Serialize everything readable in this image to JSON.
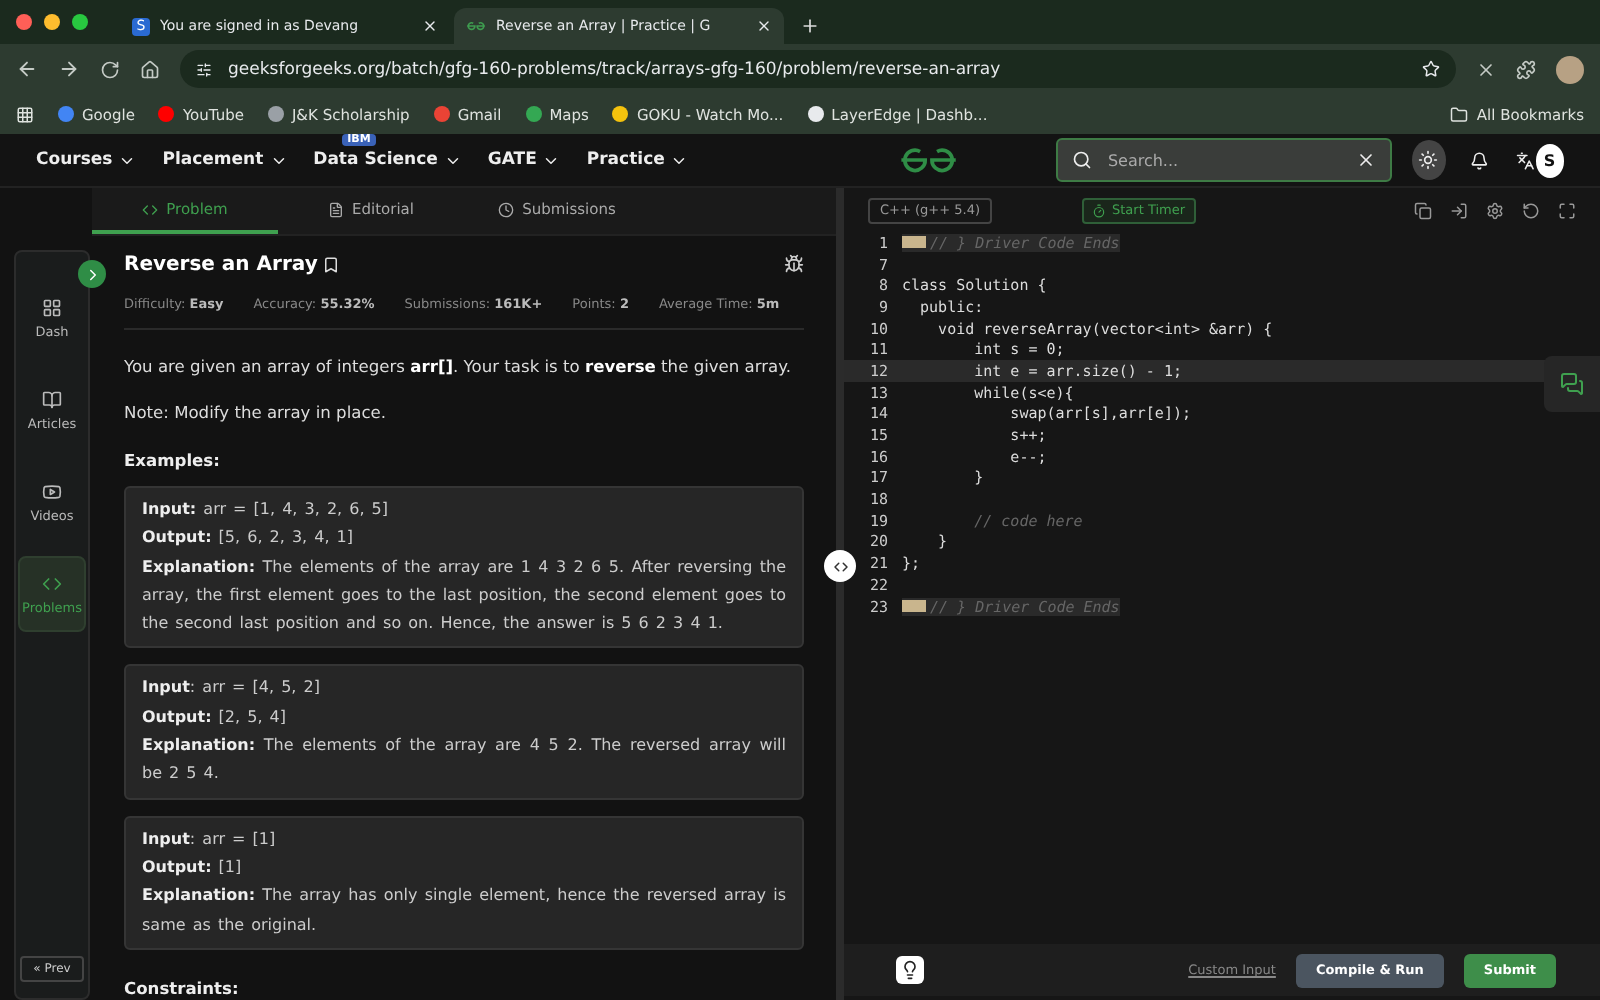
{
  "browser": {
    "tabs": [
      {
        "title": "You are signed in as Devang",
        "favicon": "S",
        "selected": false
      },
      {
        "title": "Reverse an Array | Practice | G",
        "selected": true
      }
    ],
    "url": "geeksforgeeks.org/batch/gfg-160-problems/track/arrays-gfg-160/problem/reverse-an-array",
    "bookmarks": [
      {
        "label": "Google",
        "color": "#4285f4"
      },
      {
        "label": "YouTube",
        "color": "#ff0000"
      },
      {
        "label": "J&K Scholarship",
        "color": "#9aa0a6"
      },
      {
        "label": "Gmail",
        "color": "#ea4335"
      },
      {
        "label": "Maps",
        "color": "#34a853"
      },
      {
        "label": "GOKU - Watch Mo...",
        "color": "#f4c20d"
      },
      {
        "label": "LayerEdge | Dashb...",
        "color": "#e8eaed"
      }
    ],
    "all_bookmarks": "All Bookmarks"
  },
  "nav": {
    "items": [
      {
        "label": "Courses"
      },
      {
        "label": "Placement"
      },
      {
        "label": "Data Science",
        "badge": "IBM"
      },
      {
        "label": "GATE"
      },
      {
        "label": "Practice"
      }
    ],
    "search": {
      "placeholder": "Search..."
    },
    "avatar": "S"
  },
  "problem_tabs": [
    {
      "label": "Problem",
      "selected": true
    },
    {
      "label": "Editorial",
      "selected": false
    },
    {
      "label": "Submissions",
      "selected": false
    }
  ],
  "sidebar": {
    "items": [
      {
        "label": "Dash",
        "selected": false
      },
      {
        "label": "Articles",
        "selected": false
      },
      {
        "label": "Videos",
        "selected": false
      },
      {
        "label": "Problems",
        "selected": true
      }
    ],
    "prev": "« Prev"
  },
  "problem": {
    "title": "Reverse an Array",
    "meta": [
      "Difficulty: **Easy**",
      "Accuracy: **55.32%**",
      "Submissions: **161K+**",
      "Points: **2**",
      "Average Time: **5m**"
    ],
    "paragraphs": [
      "You are given an array of integers **arr[]**. Your task is to **reverse** the given array.",
      "Note: Modify the array in place."
    ],
    "examples_heading": "Examples:",
    "examples": [
      {
        "lines": [
          "**Input:** arr = [1, 4, 3, 2, 6, 5]",
          "**Output:** [5, 6, 2, 3, 4, 1]",
          "**Explanation:** The elements of the array are 1 4 3 2 6 5. After reversing the array, the first element goes to the last position, the second element goes to the second last position and so on. Hence, the answer is 5 6 2 3 4 1."
        ]
      },
      {
        "lines": [
          "**Input**: arr = [4, 5, 2]",
          "**Output:** [2, 5, 4]",
          "**Explanation:** The elements of the array are 4 5 2. The reversed array will be 2 5 4."
        ]
      },
      {
        "lines": [
          "**Input**: arr = [1]",
          "**Output:** [1]",
          "**Explanation:** The array has only single element, hence the reversed array is same as the original."
        ]
      }
    ],
    "constraints_heading": "Constraints:"
  },
  "editor": {
    "language": "C++ (g++ 5.4)",
    "timer": "Start Timer",
    "lines": [
      {
        "number": "1",
        "text": "// } Driver Code Ends",
        "kind": "folded",
        "current": false
      },
      {
        "number": "7",
        "kind": "blank",
        "current": false
      },
      {
        "number": "8",
        "text": "class Solution {",
        "kind": "code",
        "current": false
      },
      {
        "number": "9",
        "text": "  public:",
        "kind": "code",
        "current": false
      },
      {
        "number": "10",
        "text": "    void reverseArray(vector<int> &arr) {",
        "kind": "code",
        "current": false
      },
      {
        "number": "11",
        "text": "        int s = 0;",
        "kind": "code",
        "current": false
      },
      {
        "number": "12",
        "text": "        int e = arr.size() - 1;",
        "kind": "code",
        "current": true
      },
      {
        "number": "13",
        "text": "        while(s<e){",
        "kind": "code",
        "current": false
      },
      {
        "number": "14",
        "text": "            swap(arr[s],arr[e]);",
        "kind": "code",
        "current": false
      },
      {
        "number": "15",
        "text": "            s++;",
        "kind": "code",
        "current": false
      },
      {
        "number": "16",
        "text": "            e--;",
        "kind": "code",
        "current": false
      },
      {
        "number": "17",
        "text": "        }",
        "kind": "code",
        "current": false
      },
      {
        "number": "18",
        "kind": "blank",
        "current": false
      },
      {
        "number": "19",
        "text": "        // code here",
        "kind": "comment",
        "current": false
      },
      {
        "number": "20",
        "text": "    }",
        "kind": "code",
        "current": false
      },
      {
        "number": "21",
        "text": "};",
        "kind": "code",
        "current": false
      },
      {
        "number": "22",
        "kind": "blank",
        "current": false
      },
      {
        "number": "23",
        "text": "// } Driver Code Ends",
        "kind": "folded",
        "current": false
      }
    ],
    "custom_input": "Custom Input",
    "compile": "Compile & Run",
    "submit": "Submit"
  }
}
